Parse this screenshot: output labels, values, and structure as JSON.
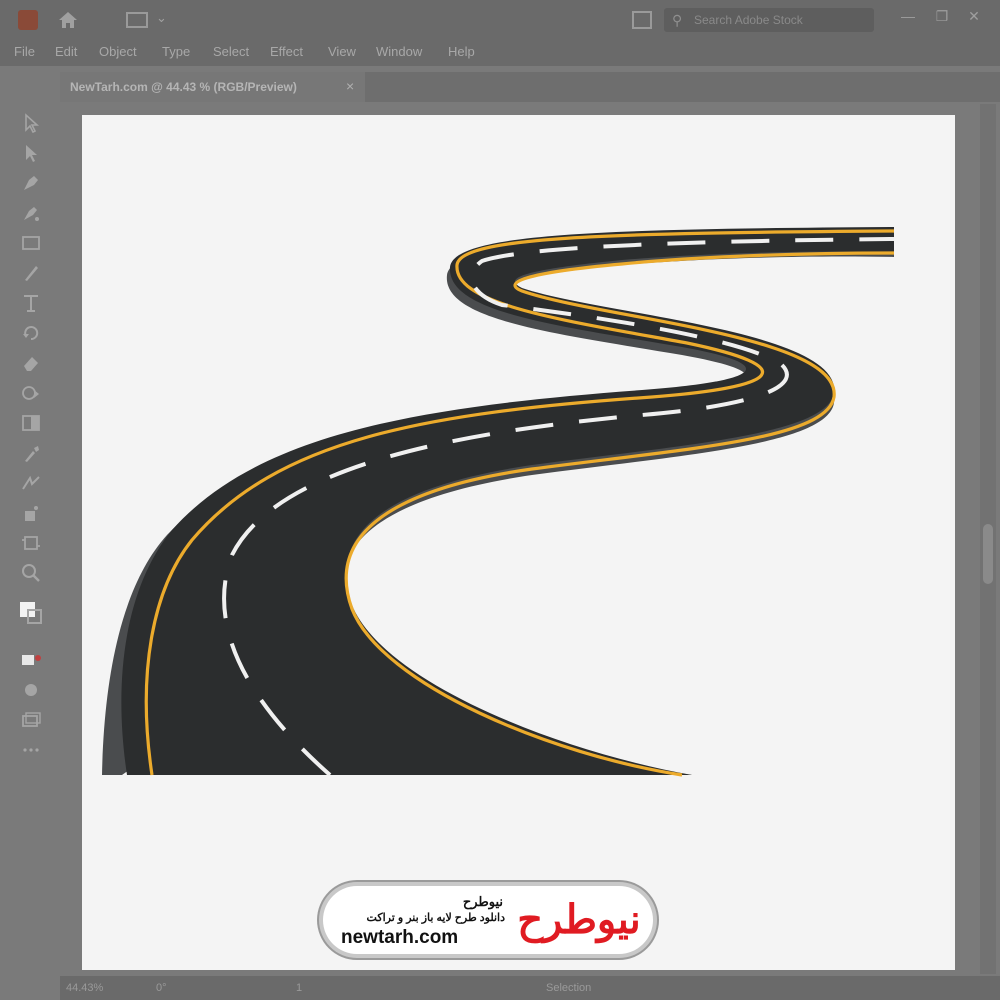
{
  "app": {
    "logo_icon": "illustrator-logo-icon",
    "home_icon": "home-icon",
    "workspace_icon": "workspace-switcher-icon",
    "arrange_icon": "arrange-documents-icon",
    "search_placeholder": "Search Adobe Stock",
    "window_controls": [
      "minimize-icon",
      "restore-icon",
      "close-icon"
    ]
  },
  "menu": [
    "File",
    "Edit",
    "Object",
    "Type",
    "Select",
    "Effect",
    "View",
    "Window",
    "Help"
  ],
  "document_tab": {
    "title": "NewTarh.com @ 44.43 % (RGB/Preview)",
    "close_label": "×"
  },
  "tools": [
    "selection-tool-icon",
    "direct-selection-tool-icon",
    "pen-tool-icon",
    "curvature-tool-icon",
    "rectangle-tool-icon",
    "paintbrush-tool-icon",
    "type-tool-icon",
    "rotate-tool-icon",
    "eraser-tool-icon",
    "shape-builder-tool-icon",
    "gradient-tool-icon",
    "eyedropper-tool-icon",
    "blend-tool-icon",
    "symbol-sprayer-tool-icon",
    "artboard-tool-icon",
    "zoom-tool-icon",
    "fill-stroke-icon",
    "drawing-modes-icon",
    "screen-mode-icon",
    "edit-toolbar-icon"
  ],
  "status": {
    "zoom": "44.43%",
    "rotation": "0°",
    "artboard_number": "1",
    "tool_name": "Selection"
  },
  "watermark": {
    "fa_title": "نیوطرح",
    "fa_subtitle": "دانلود طرح لایه باز بنر و تراکت",
    "url": "newtarh.com",
    "mark_text": "نیوطرح"
  },
  "colors": {
    "road": "#2b2d2e",
    "road_edge": "#ecab2c",
    "road_side": "#4a4c4e",
    "lane_marking": "#f0f0f0",
    "artboard": "#f4f4f4",
    "ui_dimmed": "#7a7a7a",
    "logo_red": "#e01b22"
  }
}
